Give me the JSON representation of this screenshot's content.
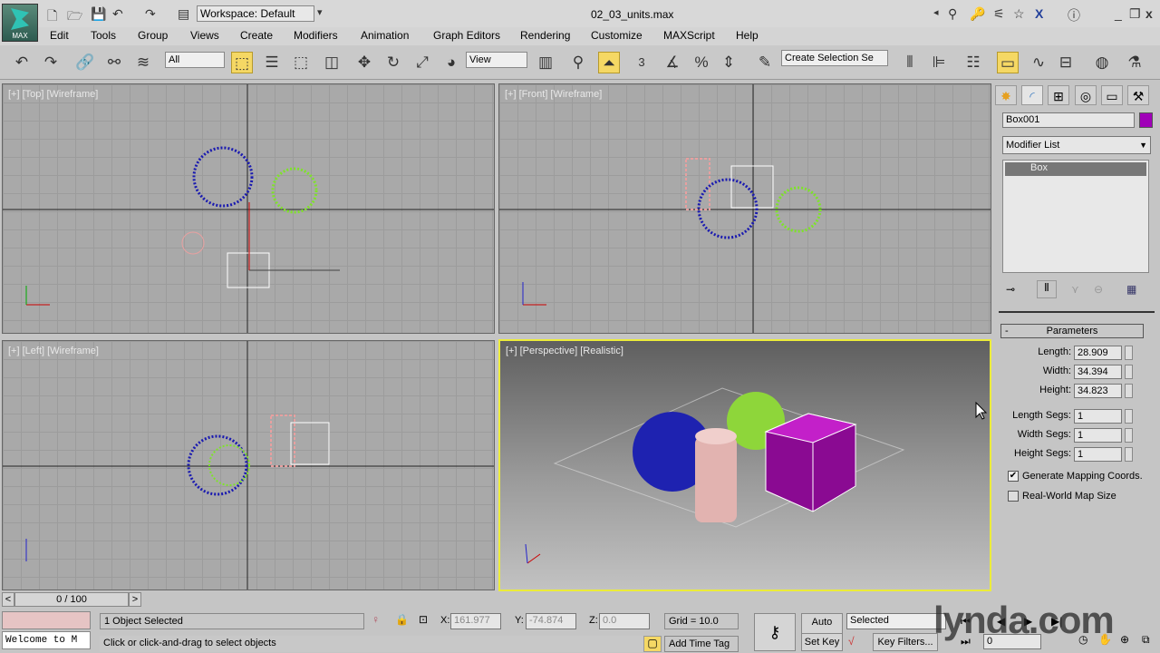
{
  "app": {
    "logo_text": "MAX",
    "workspace": "Workspace: Default",
    "file_title": "02_03_units.max"
  },
  "menu": [
    "Edit",
    "Tools",
    "Group",
    "Views",
    "Create",
    "Modifiers",
    "Animation",
    "Graph Editors",
    "Rendering",
    "Customize",
    "MAXScript",
    "Help"
  ],
  "toolbar": {
    "filter": "All",
    "ref_coord": "View",
    "selection_set": "Create Selection Se",
    "snap_label": "3"
  },
  "viewports": {
    "top": "[+] [Top] [Wireframe]",
    "front": "[+] [Front] [Wireframe]",
    "left": "[+] [Left] [Wireframe]",
    "perspective": "[+] [Perspective] [Realistic]"
  },
  "panel": {
    "object_name": "Box001",
    "object_color": "#a000b8",
    "modifier_list": "Modifier List",
    "stack_item": "Box",
    "rollout": "Parameters",
    "params": [
      {
        "label": "Length:",
        "value": "28.909"
      },
      {
        "label": "Width:",
        "value": "34.394"
      },
      {
        "label": "Height:",
        "value": "34.823"
      }
    ],
    "segs": [
      {
        "label": "Length Segs:",
        "value": "1"
      },
      {
        "label": "Width Segs:",
        "value": "1"
      },
      {
        "label": "Height Segs:",
        "value": "1"
      }
    ],
    "checks": [
      {
        "label": "Generate Mapping Coords.",
        "checked": true
      },
      {
        "label": "Real-World Map Size",
        "checked": false
      }
    ]
  },
  "timeline": {
    "frame": "0 / 100",
    "prev": "<",
    "next": ">"
  },
  "status": {
    "selected": "1 Object Selected",
    "prompt": "Click or click-and-drag to select objects",
    "listener": "Welcome to M",
    "x_label": "X:",
    "x": "161.977",
    "y_label": "Y:",
    "y": "-74.874",
    "z_label": "Z:",
    "z": "0.0",
    "grid": "Grid = 10.0",
    "add_time_tag": "Add Time Tag",
    "auto_key": "Auto Key",
    "set_key": "Set Key",
    "key_mode": "Selected",
    "key_filters": "Key Filters...",
    "current_frame": "0"
  },
  "watermark": "lynda.com"
}
